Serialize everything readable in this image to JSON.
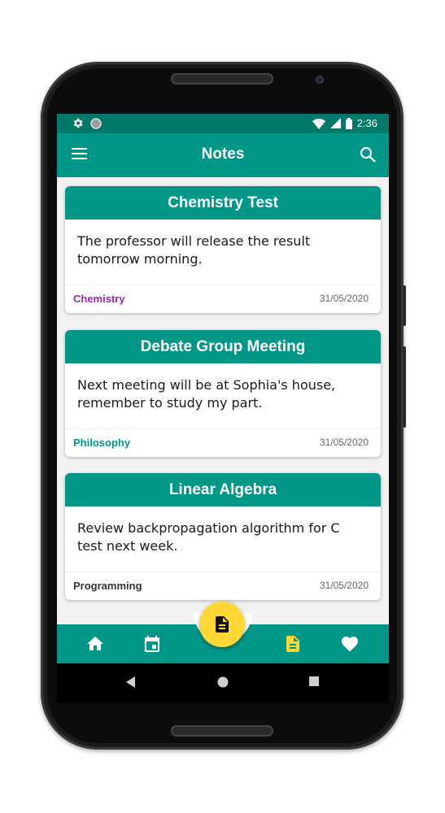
{
  "status_bar": {
    "time": "2:36"
  },
  "app_bar": {
    "title": "Notes"
  },
  "notes": [
    {
      "title": "Chemistry Test",
      "body": "The professor will release the result tomorrow morning.",
      "tag": "Chemistry",
      "tag_color": "#9c27b0",
      "date": "31/05/2020"
    },
    {
      "title": "Debate Group Meeting",
      "body": "Next meeting will be at Sophia's house, remember to study my part.",
      "tag": "Philosophy",
      "tag_color": "#009688",
      "date": "31/05/2020"
    },
    {
      "title": "Linear Algebra",
      "body": "Review backpropagation algorithm for C test next week.",
      "tag": "Programming",
      "tag_color": "#333333",
      "date": "31/05/2020"
    }
  ],
  "bottom_nav": {
    "items": [
      "home-icon",
      "calendar-icon",
      "notes-icon",
      "favorite-icon"
    ],
    "active": "notes-icon",
    "fab_icon": "add-note-icon"
  },
  "colors": {
    "primary": "#009688",
    "primary_dark": "#00796b",
    "accent": "#fdd835"
  }
}
